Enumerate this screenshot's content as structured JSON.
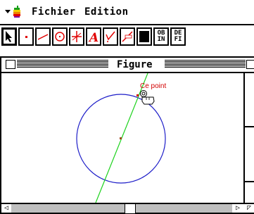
{
  "menubar": {
    "apple_menu": "apple-menu",
    "items": [
      "Fichier",
      "Edition"
    ]
  },
  "toolbar": {
    "tools": [
      {
        "name": "pointer-tool",
        "icon": "arrow-icon",
        "selected": true
      },
      {
        "name": "point-tool",
        "icon": "point-icon"
      },
      {
        "name": "line-tool",
        "icon": "line-icon"
      },
      {
        "name": "circle-tool",
        "icon": "circle-icon"
      },
      {
        "name": "construction-tool",
        "icon": "perpendicular-icon"
      },
      {
        "name": "text-tool",
        "icon": "letter-a-icon"
      },
      {
        "name": "check-tool",
        "icon": "check-icon"
      },
      {
        "name": "measure-tool",
        "icon": "measure-icon"
      },
      {
        "name": "display-tool",
        "icon": "filled-square-icon"
      },
      {
        "name": "ob-in-tool",
        "label_top": "OB",
        "label_bottom": "IN"
      },
      {
        "name": "de-fi-tool",
        "label_top": "DE",
        "label_bottom": "FI"
      }
    ]
  },
  "window": {
    "title": "Figure",
    "figure": {
      "point_label": "Ce point",
      "colors": {
        "circle": "#1c1cc8",
        "line": "#1cd21c",
        "label": "#d20000",
        "center": "#a0481c"
      }
    }
  }
}
